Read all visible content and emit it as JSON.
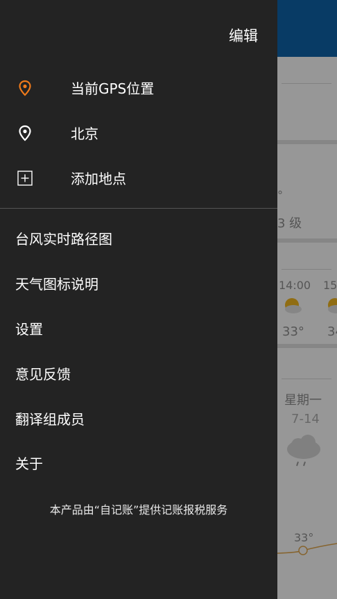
{
  "drawer": {
    "edit_label": "编辑",
    "locations": [
      {
        "label": "当前GPS位置",
        "icon": "location-pin-icon",
        "color": "#f07a1a"
      },
      {
        "label": "北京",
        "icon": "location-pin-icon",
        "color": "#ffffff"
      }
    ],
    "add_location": {
      "label": "添加地点",
      "icon": "plus-box-icon"
    },
    "menu_items": [
      {
        "label": "台风实时路径图"
      },
      {
        "label": "天气图标说明"
      },
      {
        "label": "设置"
      },
      {
        "label": "意见反馈"
      },
      {
        "label": "翻译组成员"
      },
      {
        "label": "关于"
      }
    ],
    "footer_note": "本产品由“自记账”提供记账报税服务"
  },
  "background": {
    "wind_level_text": "3 级",
    "degree_mark": "°",
    "hourly_time_1": "14:00",
    "hourly_time_2": "15",
    "hourly_temp_1": "33°",
    "hourly_temp_2": "34",
    "forecast_day": "星期一",
    "forecast_date": "7-14",
    "forecast_temp": "33°",
    "colors": {
      "header": "#0d5fa3",
      "accent_orange": "#f07a1a",
      "drawer_bg": "#232323"
    }
  }
}
